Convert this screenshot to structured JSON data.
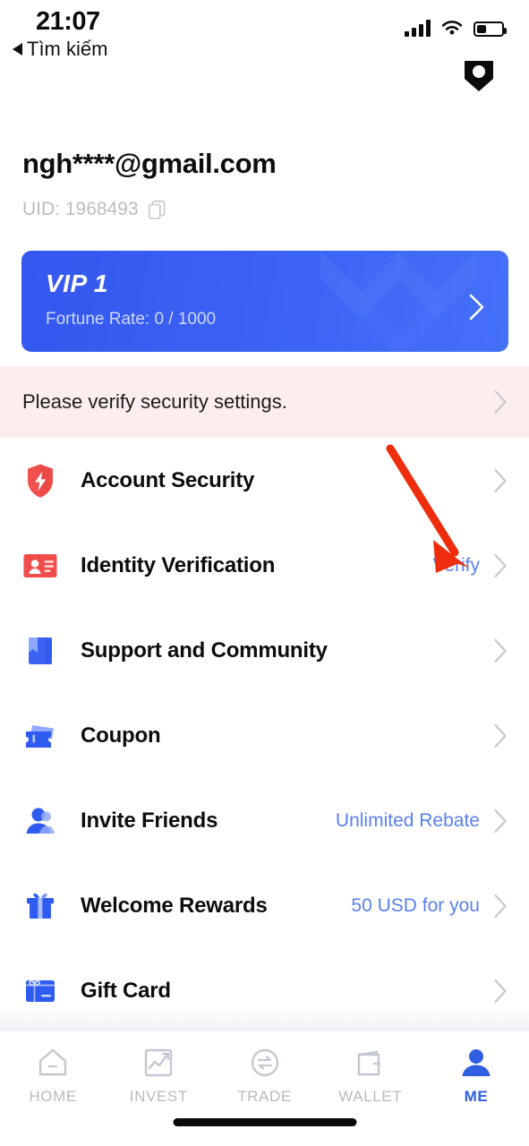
{
  "status_bar": {
    "time": "21:07",
    "back_label": "Tìm kiếm",
    "signal_icon": "cellular-signal-icon",
    "wifi_icon": "wifi-icon",
    "battery_icon": "battery-icon",
    "battery_level_percent": 34
  },
  "header": {
    "app_badge_icon": "shield-badge-icon"
  },
  "account": {
    "email": "ngh****@gmail.com",
    "uid_label": "UID: 1968493",
    "copy_icon": "copy-icon"
  },
  "vip_card": {
    "title": "VIP 1",
    "subtitle": "Fortune Rate: 0 / 1000",
    "chevron_icon": "chevron-right-icon",
    "gradient_from": "#3457ef",
    "gradient_to": "#4570f8"
  },
  "security_banner": {
    "text": "Please verify security settings.",
    "chevron_icon": "chevron-right-icon",
    "background_color": "#fdeeee"
  },
  "menu": {
    "items": [
      {
        "label": "Account Security",
        "icon": "shield-bolt-icon",
        "value": "",
        "chevron_icon": "chevron-right-icon"
      },
      {
        "label": "Identity Verification",
        "icon": "id-card-icon",
        "value": "Verify",
        "chevron_icon": "chevron-right-icon"
      },
      {
        "label": "Support and Community",
        "icon": "book-bookmark-icon",
        "value": "",
        "chevron_icon": "chevron-right-icon"
      },
      {
        "label": "Coupon",
        "icon": "ticket-icon",
        "value": "",
        "chevron_icon": "chevron-right-icon"
      },
      {
        "label": "Invite Friends",
        "icon": "person-icon",
        "value": "Unlimited Rebate",
        "chevron_icon": "chevron-right-icon"
      },
      {
        "label": "Welcome Rewards",
        "icon": "gift-icon",
        "value": "50 USD for you",
        "chevron_icon": "chevron-right-icon"
      },
      {
        "label": "Gift Card",
        "icon": "gift-card-icon",
        "value": "",
        "chevron_icon": "chevron-right-icon"
      }
    ],
    "link_color": "#5a7ff0"
  },
  "annotation": {
    "type": "arrow",
    "color": "#ee2d0c",
    "points_to": "Verify"
  },
  "tabbar": {
    "tabs": [
      {
        "label": "HOME",
        "icon": "home-icon",
        "active": false
      },
      {
        "label": "INVEST",
        "icon": "chart-square-icon",
        "active": false
      },
      {
        "label": "TRADE",
        "icon": "exchange-circle-icon",
        "active": false
      },
      {
        "label": "WALLET",
        "icon": "wallet-icon",
        "active": false
      },
      {
        "label": "ME",
        "icon": "person-icon",
        "active": true
      }
    ],
    "active_color": "#2f5fe0",
    "inactive_color": "#b6bac4"
  }
}
